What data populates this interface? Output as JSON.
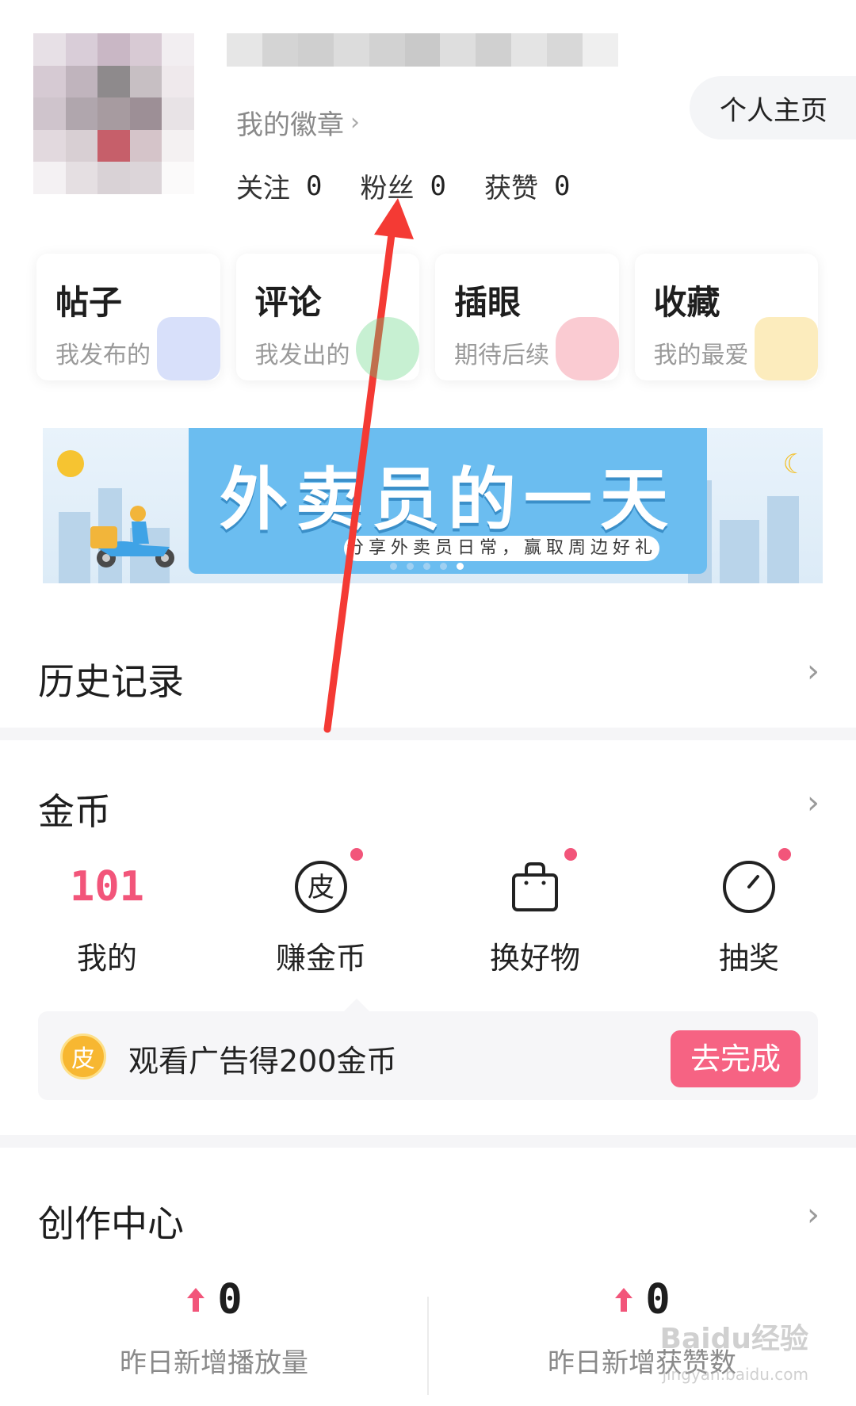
{
  "header": {
    "avatar_alt": "avatar",
    "badge_label": "我的徽章",
    "profile_button": "个人主页",
    "stats": [
      {
        "label": "关注",
        "value": "0"
      },
      {
        "label": "粉丝",
        "value": "0"
      },
      {
        "label": "获赞",
        "value": "0"
      }
    ]
  },
  "cards": [
    {
      "title": "帖子",
      "subtitle": "我发布的",
      "accent": "#8fa6f2"
    },
    {
      "title": "评论",
      "subtitle": "我发出的",
      "accent": "#5fd37d"
    },
    {
      "title": "插眼",
      "subtitle": "期待后续",
      "accent": "#f06b7d"
    },
    {
      "title": "收藏",
      "subtitle": "我的最爱",
      "accent": "#f7c843"
    }
  ],
  "banner": {
    "title": "外卖员的一天",
    "subtitle": "分享外卖员日常，赢取周边好礼",
    "page_count": 5,
    "active_index": 4
  },
  "history": {
    "title": "历史记录"
  },
  "coins": {
    "title": "金币",
    "items": [
      {
        "value": "101",
        "label": "我的",
        "dot": false
      },
      {
        "icon": "pi-coin-icon",
        "icon_char": "皮",
        "label": "赚金币",
        "dot": true
      },
      {
        "icon": "shopping-bag-icon",
        "label": "换好物",
        "dot": true
      },
      {
        "icon": "timer-dial-icon",
        "label": "抽奖",
        "dot": true
      }
    ],
    "task": {
      "icon_char": "皮",
      "text": "观看广告得200金币",
      "button": "去完成"
    }
  },
  "creation": {
    "title": "创作中心",
    "metrics": [
      {
        "value": "0",
        "label": "昨日新增播放量"
      },
      {
        "value": "0",
        "label": "昨日新增获赞数"
      }
    ]
  },
  "watermark": {
    "brand": "Baidu经验",
    "url": "jingyan.baidu.com"
  },
  "colors": {
    "accent_pink": "#f2557a",
    "button_pink": "#f66383",
    "annotation_red": "#f43a34"
  }
}
